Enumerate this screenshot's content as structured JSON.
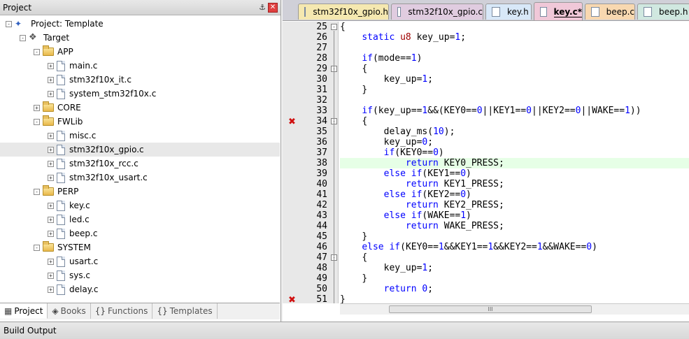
{
  "project_panel": {
    "title": "Project",
    "pin_glyph": "⚓",
    "close_glyph": "✕",
    "tree": [
      {
        "label": "Project: Template",
        "icon": "project-icon",
        "expander": "-",
        "depth": 0
      },
      {
        "label": "Target",
        "icon": "target-icon",
        "expander": "-",
        "depth": 1
      },
      {
        "label": "APP",
        "icon": "folder-icon",
        "expander": "-",
        "depth": 2
      },
      {
        "label": "main.c",
        "icon": "file-icon",
        "expander": "+",
        "depth": 3
      },
      {
        "label": "stm32f10x_it.c",
        "icon": "file-icon",
        "expander": "+",
        "depth": 3
      },
      {
        "label": "system_stm32f10x.c",
        "icon": "file-icon",
        "expander": "+",
        "depth": 3
      },
      {
        "label": "CORE",
        "icon": "folder-icon",
        "expander": "+",
        "depth": 2
      },
      {
        "label": "FWLib",
        "icon": "folder-icon",
        "expander": "-",
        "depth": 2
      },
      {
        "label": "misc.c",
        "icon": "file-icon",
        "expander": "+",
        "depth": 3
      },
      {
        "label": "stm32f10x_gpio.c",
        "icon": "file-icon",
        "expander": "+",
        "depth": 3,
        "selected": true
      },
      {
        "label": "stm32f10x_rcc.c",
        "icon": "file-icon",
        "expander": "+",
        "depth": 3
      },
      {
        "label": "stm32f10x_usart.c",
        "icon": "file-icon",
        "expander": "+",
        "depth": 3
      },
      {
        "label": "PERP",
        "icon": "folder-icon",
        "expander": "-",
        "depth": 2
      },
      {
        "label": "key.c",
        "icon": "file-icon",
        "expander": "+",
        "depth": 3
      },
      {
        "label": "led.c",
        "icon": "file-icon",
        "expander": "+",
        "depth": 3
      },
      {
        "label": "beep.c",
        "icon": "file-icon",
        "expander": "+",
        "depth": 3
      },
      {
        "label": "SYSTEM",
        "icon": "folder-icon",
        "expander": "-",
        "depth": 2
      },
      {
        "label": "usart.c",
        "icon": "file-icon",
        "expander": "+",
        "depth": 3
      },
      {
        "label": "sys.c",
        "icon": "file-icon",
        "expander": "+",
        "depth": 3
      },
      {
        "label": "delay.c",
        "icon": "file-icon",
        "expander": "+",
        "depth": 3
      }
    ],
    "bottom_tabs": [
      {
        "label": "Project",
        "icon": "project-tab-icon",
        "glyph": "▦",
        "active": true
      },
      {
        "label": "Books",
        "icon": "books-icon",
        "glyph": "◈",
        "active": false
      },
      {
        "label": "Functions",
        "icon": "functions-icon",
        "glyph": "{}",
        "active": false
      },
      {
        "label": "Templates",
        "icon": "templates-icon",
        "glyph": "{}",
        "active": false
      }
    ]
  },
  "editor": {
    "tabs": [
      {
        "label": "stm32f10x_gpio.h",
        "color": "#f5e8b0",
        "active": false
      },
      {
        "label": "stm32f10x_gpio.c",
        "color": "#e0cce0",
        "active": false
      },
      {
        "label": "key.h",
        "color": "#d8e8f8",
        "active": false
      },
      {
        "label": "key.c*",
        "color": "#f0c8d8",
        "active": true
      },
      {
        "label": "beep.c",
        "color": "#f8d8b0",
        "active": false
      },
      {
        "label": "beep.h",
        "color": "#d0e8e0",
        "active": false
      }
    ],
    "lines": [
      {
        "n": "25",
        "text": "{",
        "fold": "-"
      },
      {
        "n": "26",
        "text": "    static u8 key_up=1;"
      },
      {
        "n": "27",
        "text": ""
      },
      {
        "n": "28",
        "text": "    if(mode==1)"
      },
      {
        "n": "29",
        "text": "    {",
        "fold": "-"
      },
      {
        "n": "30",
        "text": "        key_up=1;"
      },
      {
        "n": "31",
        "text": "    }"
      },
      {
        "n": "32",
        "text": ""
      },
      {
        "n": "33",
        "text": "    if(key_up==1&&(KEY0==0||KEY1==0||KEY2==0||WAKE==1))"
      },
      {
        "n": "34",
        "text": "    {",
        "fold": "-",
        "error": true
      },
      {
        "n": "35",
        "text": "        delay_ms(10);"
      },
      {
        "n": "36",
        "text": "        key_up=0;"
      },
      {
        "n": "37",
        "text": "        if(KEY0==0)"
      },
      {
        "n": "38",
        "text": "            return KEY0_PRESS;",
        "highlight": true
      },
      {
        "n": "39",
        "text": "        else if(KEY1==0)"
      },
      {
        "n": "40",
        "text": "            return KEY1_PRESS;"
      },
      {
        "n": "41",
        "text": "        else if(KEY2==0)"
      },
      {
        "n": "42",
        "text": "            return KEY2_PRESS;"
      },
      {
        "n": "43",
        "text": "        else if(WAKE==1)"
      },
      {
        "n": "44",
        "text": "            return WAKE_PRESS;"
      },
      {
        "n": "45",
        "text": "    }"
      },
      {
        "n": "46",
        "text": "    else if(KEY0==1&&KEY1==1&&KEY2==1&&WAKE==0)"
      },
      {
        "n": "47",
        "text": "    {",
        "fold": "-"
      },
      {
        "n": "48",
        "text": "        key_up=1;"
      },
      {
        "n": "49",
        "text": "    }"
      },
      {
        "n": "50",
        "text": "        return 0;"
      },
      {
        "n": "51",
        "text": "}",
        "error": true
      }
    ],
    "error_glyph": "✖",
    "scroll_thumb_glyph": "III"
  },
  "build_output": {
    "title": "Build Output"
  }
}
